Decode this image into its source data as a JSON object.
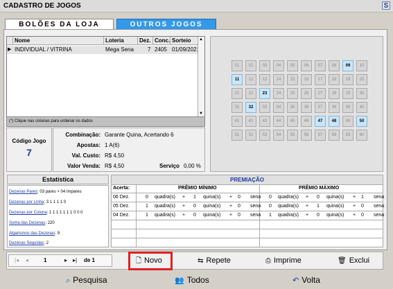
{
  "window": {
    "title": "CADASTRO DE JOGOS",
    "close_label": "S"
  },
  "tabs": [
    {
      "label": "BOLÕES DA LOJA"
    },
    {
      "label": "OUTROS JOGOS"
    }
  ],
  "grid": {
    "columns": [
      "Nome",
      "Loteria",
      "Dez.",
      "Conc.",
      "Sorteio"
    ],
    "rows": [
      {
        "nome": "INDIVIDUAL / VITRINA",
        "loteria": "Mega Sena",
        "dez": "7",
        "conc": "2405",
        "sorteio": "01/09/2021"
      }
    ],
    "hint": "(*) Clique nas colunas para ordenar os dados"
  },
  "codigo": {
    "label": "Código Jogo",
    "value": "7"
  },
  "info": {
    "combinacao_label": "Combinação:",
    "combinacao_value": "Garante Quina, Acertando 6",
    "apostas_label": "Apostas:",
    "apostas_value": "1 A(6)",
    "custo_label": "Val. Custo:",
    "custo_value": "R$ 4,50",
    "venda_label": "Valor Venda:",
    "venda_value": "R$ 4,50",
    "servico_label": "Serviço",
    "servico_value": "0,00 %"
  },
  "numbers": {
    "all": [
      "01",
      "02",
      "03",
      "04",
      "05",
      "06",
      "07",
      "08",
      "09",
      "10",
      "11",
      "12",
      "13",
      "14",
      "15",
      "16",
      "17",
      "18",
      "19",
      "20",
      "21",
      "22",
      "23",
      "24",
      "25",
      "26",
      "27",
      "28",
      "29",
      "30",
      "31",
      "32",
      "33",
      "34",
      "35",
      "36",
      "37",
      "38",
      "39",
      "40",
      "41",
      "42",
      "43",
      "44",
      "45",
      "46",
      "47",
      "48",
      "49",
      "50",
      "51",
      "52",
      "53",
      "54",
      "55",
      "56",
      "57",
      "58",
      "59",
      "60"
    ],
    "selected": [
      "09",
      "11",
      "23",
      "32",
      "47",
      "48",
      "50"
    ]
  },
  "estatistica": {
    "title": "Estatística",
    "rows": [
      {
        "label": "Dezenas Pares",
        "value": ": 03 pares + 04 ímpares"
      },
      {
        "label": "Dezenas por Linha",
        "value": ": 3 1 1 1 1 0"
      },
      {
        "label": "Dezenas por Coluna",
        "value": ": 1 1 1 1 1 1 1 0 0 0"
      },
      {
        "label": "Soma das Dezenas",
        "value": ": 220"
      },
      {
        "label": "Algarismos das Dezenas",
        "value": ": 9"
      },
      {
        "label": "Dezenas Seguidas",
        "value": ": 2"
      }
    ]
  },
  "premiacao": {
    "title": "PREMIAÇÃO",
    "acerta_label": "Acerta:",
    "min_label": "PRÊMIO MÍNIMO",
    "max_label": "PRÊMIO MÁXIMO",
    "rows": [
      {
        "acerta": "06 Dez.",
        "min": [
          "0",
          "quadra(s)",
          "+",
          "1",
          "quina(s)",
          "+",
          "0",
          "sena"
        ],
        "max": [
          "0",
          "quadra(s)",
          "+",
          "0",
          "quina(s)",
          "+",
          "1",
          "sena"
        ]
      },
      {
        "acerta": "05 Dez.",
        "min": [
          "1",
          "quadra(s)",
          "+",
          "0",
          "quina(s)",
          "+",
          "0",
          "sena"
        ],
        "max": [
          "0",
          "quadra(s)",
          "+",
          "1",
          "quina(s)",
          "+",
          "0",
          "sena"
        ]
      },
      {
        "acerta": "04 Dez.",
        "min": [
          "1",
          "quadra(s)",
          "+",
          "0",
          "quina(s)",
          "+",
          "0",
          "sena"
        ],
        "max": [
          "1",
          "quadra(s)",
          "+",
          "0",
          "quina(s)",
          "+",
          "0",
          "sena"
        ]
      }
    ]
  },
  "nav": {
    "page": "1",
    "of_label": "de 1"
  },
  "buttons": {
    "novo": "Novo",
    "repete": "Repete",
    "imprime": "Imprime",
    "exclui": "Exclui"
  },
  "bottom": {
    "pesquisa": "Pesquisa",
    "todos": "Todos",
    "volta": "Volta"
  }
}
